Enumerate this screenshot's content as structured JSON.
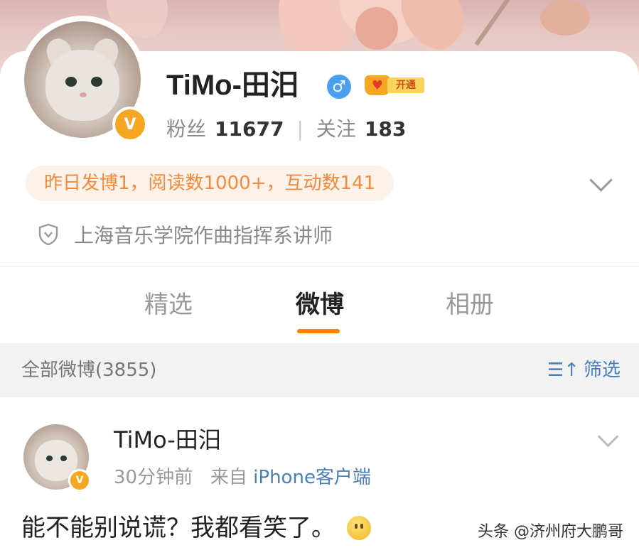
{
  "profile": {
    "name": "TiMo-田汨",
    "gender_icon": "♂",
    "vip_label": "开通",
    "verified_mark": "V",
    "fans_label": "粉丝",
    "fans_count": "11677",
    "follow_label": "关注",
    "follow_count": "183",
    "activity": "昨日发博1，阅读数1000+，互动数141",
    "title": "上海音乐学院作曲指挥系讲师"
  },
  "tabs": {
    "featured": "精选",
    "weibo": "微博",
    "album": "相册",
    "active": "微博"
  },
  "filter": {
    "all_posts": "全部微博(3855)",
    "filter_label": "筛选",
    "filter_icon": "☰↑"
  },
  "post": {
    "author": "TiMo-田汨",
    "time": "30分钟前",
    "from_label": "来自",
    "source": "iPhone客户端",
    "text": "能不能别说谎？我都看笑了。"
  },
  "watermark": "头条 @济州府大鹏哥",
  "colors": {
    "accent": "#ff8200",
    "link": "#4a7fb8",
    "activity_text": "#f08a3c",
    "verified": "#f5a623"
  }
}
